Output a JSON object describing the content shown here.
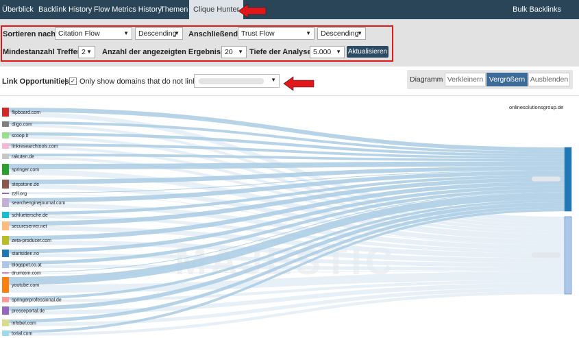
{
  "nav": {
    "tabs": [
      {
        "label": "Überblick",
        "active": false
      },
      {
        "label": "Backlink History",
        "active": false
      },
      {
        "label": "Flow Metrics History",
        "active": false
      },
      {
        "label": "Themen",
        "active": false
      },
      {
        "label": "Clique Hunter",
        "active": true
      }
    ],
    "right_label": "Bulk Backlinks"
  },
  "filters": {
    "sort_label": "Sortieren nach:",
    "sort_value": "Citation Flow",
    "sort_order": "Descending",
    "then_label": "Anschließend:",
    "then_value": "Trust Flow",
    "then_order": "Descending",
    "min_hits_label": "Mindestanzahl Treffer:",
    "min_hits_value": "2",
    "results_label": "Anzahl der angezeigten Ergebnisse:",
    "results_value": "20",
    "depth_label": "Tiefe der Analyse:",
    "depth_value": "5.000",
    "update_button": "Aktualisieren"
  },
  "opportunities": {
    "title": "Link Opportunities",
    "separator": "|",
    "checkbox_checked": true,
    "checkbox_label": "Only show domains that do not link to",
    "domain_value": ""
  },
  "diagram": {
    "label": "Diagramm",
    "buttons": [
      {
        "label": "Verkleinern",
        "active": false
      },
      {
        "label": "Vergrößern",
        "active": true
      },
      {
        "label": "Ausblenden",
        "active": false
      }
    ]
  },
  "sankey": {
    "target_label": "onlinesolutionsgroup.de",
    "watermark": "MAJESTIC",
    "sources": [
      {
        "name": "flipboard.com",
        "color": "#d62728"
      },
      {
        "name": "diigo.com",
        "color": "#7f7f7f"
      },
      {
        "name": "scoop.it",
        "color": "#98df8a"
      },
      {
        "name": "linkresearchtools.com",
        "color": "#f7b6d2"
      },
      {
        "name": "rakuten.de",
        "color": "#c7c7c7"
      },
      {
        "name": "springer.com",
        "color": "#2ca02c"
      },
      {
        "name": "stepstone.de",
        "color": "#8c564b"
      },
      {
        "name": "zzll.org",
        "color": "#9467bd"
      },
      {
        "name": "searchenginejournal.com",
        "color": "#c5b0d5"
      },
      {
        "name": "schluetersche.de",
        "color": "#17becf"
      },
      {
        "name": "secureserver.net",
        "color": "#ffbb78"
      },
      {
        "name": "zeta-producer.com",
        "color": "#bcbd22"
      },
      {
        "name": "startsiden.no",
        "color": "#1f77b4"
      },
      {
        "name": "blogspot.co.at",
        "color": "#aec7e8"
      },
      {
        "name": "drumtom.com",
        "color": "#e377c2"
      },
      {
        "name": "youtube.com",
        "color": "#ff7f0e"
      },
      {
        "name": "springerprofessional.de",
        "color": "#ff9896"
      },
      {
        "name": "presseportal.de",
        "color": "#9467bd"
      },
      {
        "name": "infobel.com",
        "color": "#dbdb8d"
      },
      {
        "name": "torial.com",
        "color": "#9edae5"
      }
    ],
    "targets": [
      {
        "color": "#1f77b4"
      },
      {
        "color": "#aec7e8"
      }
    ]
  }
}
